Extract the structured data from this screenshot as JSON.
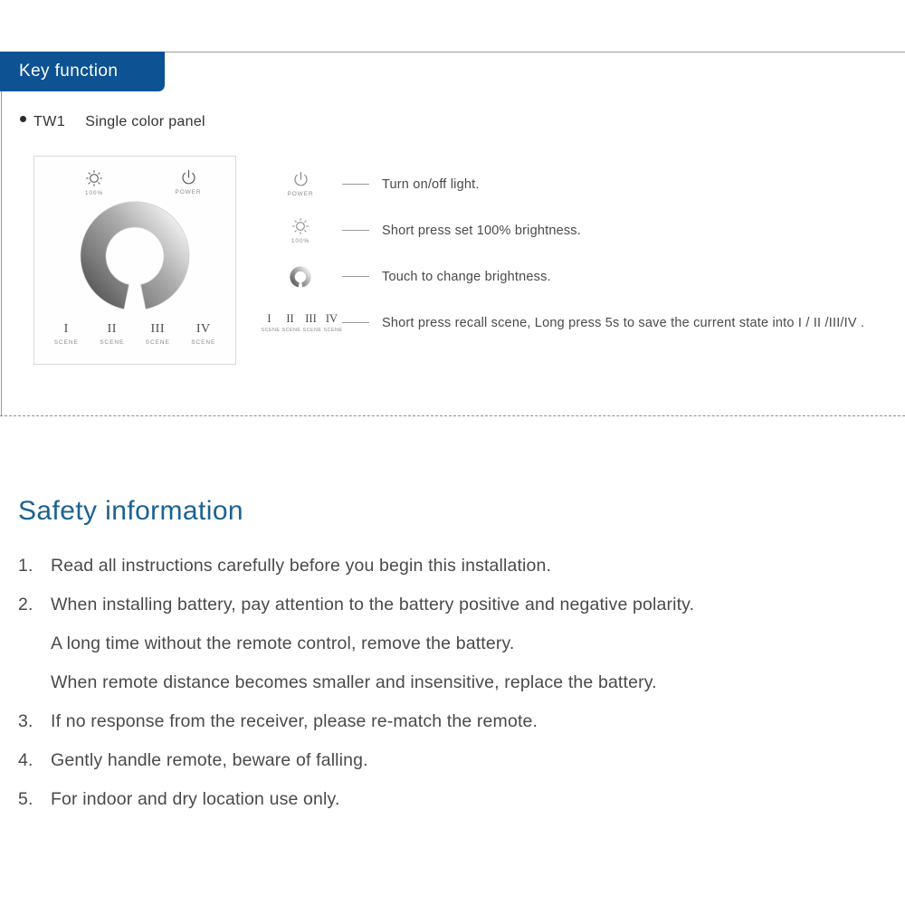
{
  "colors": {
    "tab_blue": "#0d5293",
    "heading_blue": "#1b6292",
    "body_gray": "#4a4a4a",
    "rule_gray": "#9a9a9a"
  },
  "key_function": {
    "tab_label": "Key function",
    "model_code": "TW1",
    "model_desc": "Single color panel",
    "panel": {
      "brightness_icon": "sun-icon",
      "brightness_caption": "100%",
      "power_icon": "power-icon",
      "power_caption": "POWER",
      "ring_icon": "brightness-ring",
      "scenes": [
        {
          "num": "I",
          "sub": "SCENE"
        },
        {
          "num": "II",
          "sub": "SCENE"
        },
        {
          "num": "III",
          "sub": "SCENE"
        },
        {
          "num": "IV",
          "sub": "SCENE"
        }
      ]
    },
    "legend": [
      {
        "icon": "power-icon",
        "caption": "POWER",
        "text": "Turn on/off light."
      },
      {
        "icon": "sun-icon",
        "caption": "100%",
        "text": "Short press set 100% brightness."
      },
      {
        "icon": "brightness-ring",
        "caption": "",
        "text": "Touch to change brightness."
      },
      {
        "icon": "scene-group",
        "caption": "",
        "text": "Short press recall scene, Long press 5s to save the current state into I / II /III/IV .",
        "scenes": [
          {
            "num": "I",
            "sub": "SCENE"
          },
          {
            "num": "II",
            "sub": "SCENE"
          },
          {
            "num": "III",
            "sub": "SCENE"
          },
          {
            "num": "IV",
            "sub": "SCENE"
          }
        ]
      }
    ]
  },
  "safety": {
    "title": "Safety information",
    "items": [
      {
        "num": "1.",
        "text": "Read all instructions carefully before you begin this installation."
      },
      {
        "num": "2.",
        "text": "When installing battery, pay attention to the battery positive and negative polarity."
      },
      {
        "num": "",
        "text": "A long time without the remote control, remove the battery."
      },
      {
        "num": "",
        "text": "When remote distance becomes smaller and insensitive, replace the battery."
      },
      {
        "num": "3.",
        "text": "If no response from the receiver, please re-match the remote."
      },
      {
        "num": "4.",
        "text": "Gently handle remote, beware of falling."
      },
      {
        "num": "5.",
        "text": "For indoor and dry location use only."
      }
    ]
  }
}
